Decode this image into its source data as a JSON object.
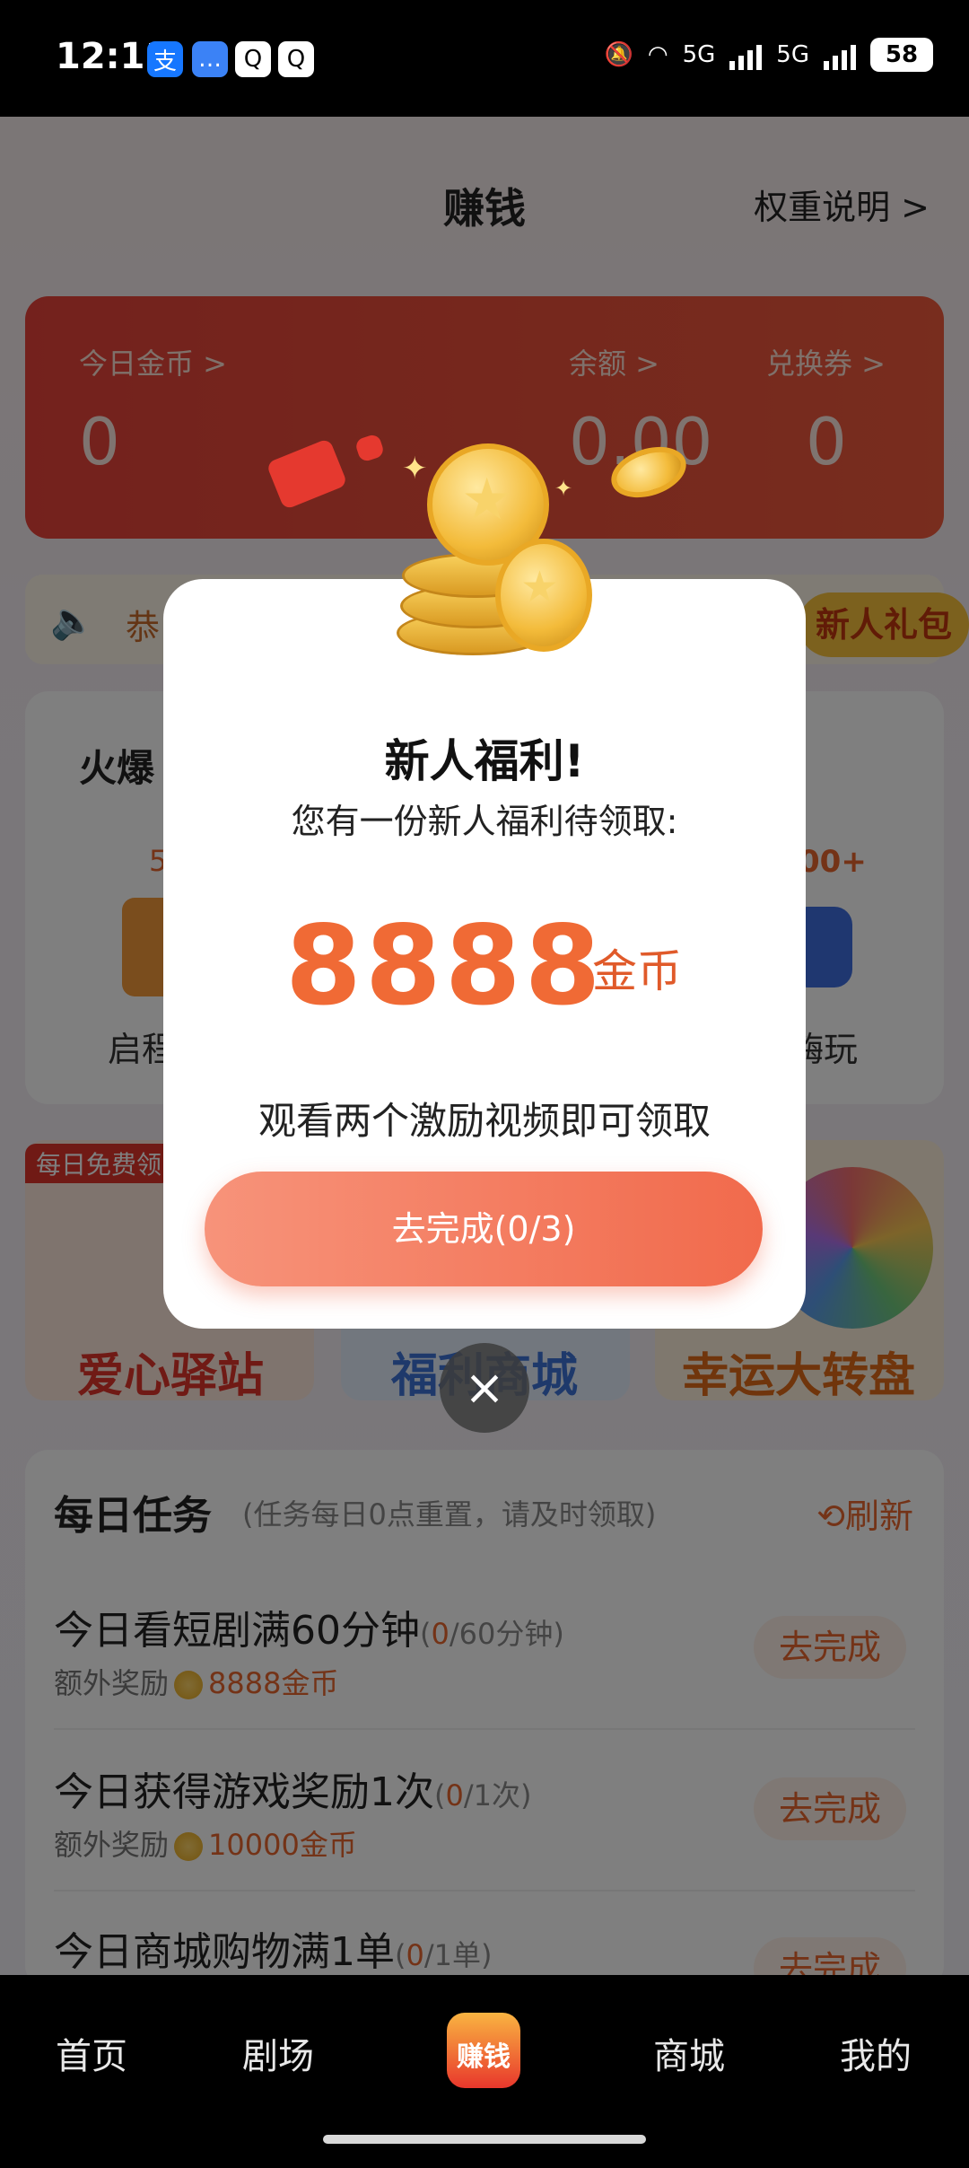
{
  "status_bar": {
    "time": "12:11",
    "apps": [
      "支",
      "…",
      "Q",
      "Q"
    ],
    "network": "5G",
    "battery": "58"
  },
  "header": {
    "title": "赚钱",
    "right_link": "权重说明 >"
  },
  "balance_card": {
    "coins_label": "今日金币 >",
    "coins_value": "0",
    "balance_label": "余额 >",
    "balance_value": "0.00",
    "voucher_label": "兑换券 >",
    "voucher_value": "0"
  },
  "notice": {
    "text": "恭",
    "newbie_gift": "新人礼包"
  },
  "hot_section": {
    "title": "火爆",
    "left_badge": "5",
    "right_badge": "00+",
    "left_item": "启程",
    "right_item": "嗨玩"
  },
  "promos": {
    "free_tag": "每日免费领",
    "items": [
      "爱心驿站",
      "福利商城",
      "幸运大转盘"
    ]
  },
  "daily_tasks": {
    "title": "每日任务",
    "subtitle": "(任务每日0点重置，请及时领取)",
    "refresh": "刷新",
    "items": [
      {
        "name": "今日看短剧满60分钟",
        "progress_done": "0",
        "progress_total": "/60分钟)",
        "reward_label": "额外奖励",
        "reward": "8888金币",
        "button": "去完成"
      },
      {
        "name": "今日获得游戏奖励1次",
        "progress_done": "0",
        "progress_total": "/1次)",
        "reward_label": "额外奖励",
        "reward": "10000金币",
        "button": "去完成"
      },
      {
        "name": "今日商城购物满1单",
        "progress_done": "0",
        "progress_total": "/1单)",
        "reward_label": "",
        "reward": "",
        "button": "去完成"
      }
    ]
  },
  "dialog": {
    "title": "新人福利!",
    "subtitle": "您有一份新人福利待领取:",
    "amount": "8888",
    "unit": "金币",
    "tip": "观看两个激励视频即可领取",
    "button": "去完成(0/3)",
    "close": "×"
  },
  "bottom_nav": {
    "items": [
      "首页",
      "剧场",
      "赚钱",
      "商城",
      "我的"
    ]
  },
  "colors": {
    "accent": "#f06a35",
    "red_card": "#e8433a"
  }
}
